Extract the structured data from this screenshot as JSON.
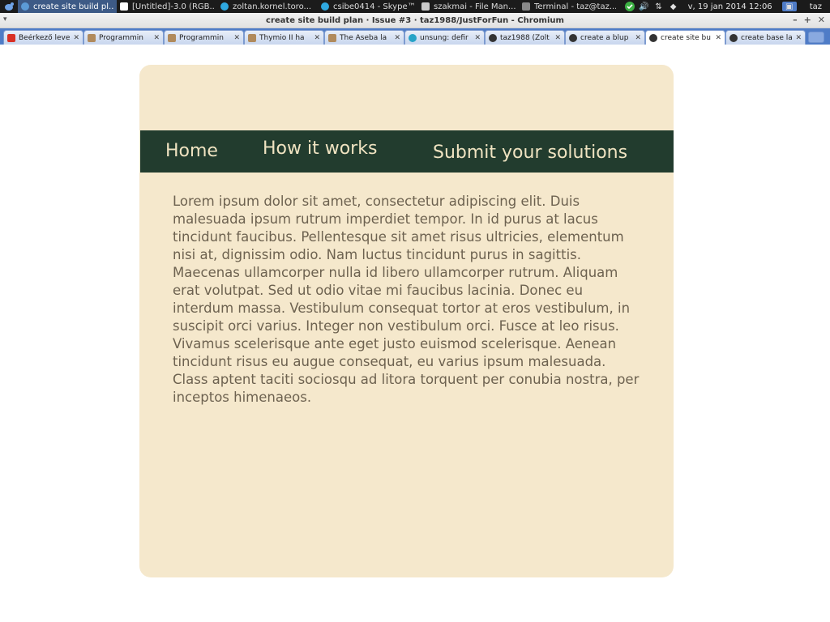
{
  "panel": {
    "tasks": [
      {
        "label": "create site build pl...",
        "active": true,
        "icon": "chromium-icon",
        "color": "#5c9bd6"
      },
      {
        "label": "[Untitled]-3.0 (RGB...",
        "active": false,
        "icon": "gimp-icon",
        "color": "#ffffff"
      },
      {
        "label": "zoltan.kornel.toro...",
        "active": false,
        "icon": "skype-icon",
        "color": "#2fa8e0"
      },
      {
        "label": "csibe0414 - Skype™",
        "active": false,
        "icon": "skype-icon",
        "color": "#2fa8e0"
      },
      {
        "label": "szakmai - File Man...",
        "active": false,
        "icon": "folder-icon",
        "color": "#c9c9c9"
      },
      {
        "label": "Terminal - taz@taz...",
        "active": false,
        "icon": "terminal-icon",
        "color": "#888888"
      }
    ],
    "clock": "v, 19 jan 2014 12:06",
    "user": "taz"
  },
  "window": {
    "title": "create site build plan · Issue #3 · taz1988/JustForFun - Chromium"
  },
  "tabs": [
    {
      "label": "Beérkező leve",
      "icon": "gmail-icon",
      "color": "#d93025",
      "active": false
    },
    {
      "label": "Programmin",
      "icon": "page-icon",
      "color": "#b08a5c",
      "active": false
    },
    {
      "label": "Programmin",
      "icon": "page-icon",
      "color": "#b08a5c",
      "active": false
    },
    {
      "label": "Thymio II ha",
      "icon": "page-icon",
      "color": "#b08a5c",
      "active": false
    },
    {
      "label": "The Aseba la",
      "icon": "page-icon",
      "color": "#b08a5c",
      "active": false
    },
    {
      "label": "unsung: defir",
      "icon": "circle-icon",
      "color": "#27a3c7",
      "active": false
    },
    {
      "label": "taz1988 (Zolt",
      "icon": "github-icon",
      "color": "#333333",
      "active": false
    },
    {
      "label": "create a blup",
      "icon": "github-icon",
      "color": "#333333",
      "active": false
    },
    {
      "label": "create site bu",
      "icon": "github-icon",
      "color": "#333333",
      "active": true
    },
    {
      "label": "create base la",
      "icon": "github-icon",
      "color": "#333333",
      "active": false
    }
  ],
  "site": {
    "nav": {
      "home": "Home",
      "how": "How it works",
      "submit": "Submit your solutions"
    },
    "body": "Lorem ipsum dolor sit amet, consectetur adipiscing elit. Duis malesuada ipsum rutrum imperdiet tempor. In id purus at lacus tincidunt faucibus. Pellentesque sit amet risus ultricies, elementum nisi at, dignissim odio. Nam luctus tincidunt purus in sagittis. Maecenas ullamcorper nulla id libero ullamcorper rutrum. Aliquam erat volutpat. Sed ut odio vitae mi faucibus lacinia. Donec eu interdum massa. Vestibulum consequat tortor at eros vestibulum, in suscipit orci varius. Integer non vestibulum orci. Fusce at leo risus. Vivamus scelerisque ante eget justo euismod scelerisque. Aenean tincidunt risus eu augue consequat, eu varius ipsum malesuada. Class aptent taciti sociosqu ad litora torquent per conubia nostra, per inceptos himenaeos."
  },
  "colors": {
    "card_bg": "#f5e8cc",
    "nav_bg": "#223c2e",
    "nav_text": "#efe3c1",
    "body_text": "#6d6250",
    "tab_strip": "#4f7cc7"
  }
}
